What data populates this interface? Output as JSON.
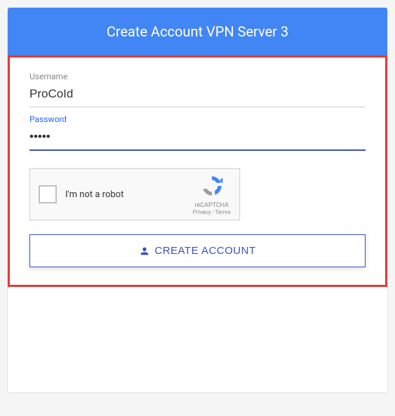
{
  "header": {
    "title": "Create Account VPN Server 3"
  },
  "form": {
    "username_label": "Username",
    "username_value": "ProCoId",
    "password_label": "Password",
    "password_value": "•••••"
  },
  "captcha": {
    "text": "I'm not a robot",
    "brand": "reCAPTCHA",
    "links": "Privacy - Terms"
  },
  "button": {
    "create_label": "CREATE ACCOUNT"
  }
}
